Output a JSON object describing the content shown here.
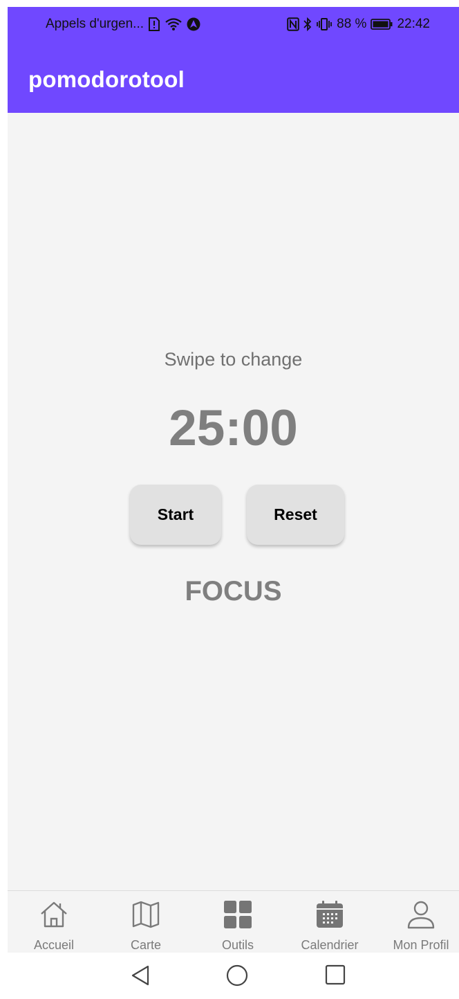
{
  "status_bar": {
    "carrier_text": "Appels d'urgen...",
    "battery_percent": "88 %",
    "time": "22:42"
  },
  "app_bar": {
    "title": "pomodorotool"
  },
  "main": {
    "hint": "Swipe to change",
    "timer": "25:00",
    "start_label": "Start",
    "reset_label": "Reset",
    "mode": "FOCUS"
  },
  "bottom_nav": {
    "items": [
      {
        "label": "Accueil",
        "icon": "home-icon"
      },
      {
        "label": "Carte",
        "icon": "map-icon"
      },
      {
        "label": "Outils",
        "icon": "grid-icon"
      },
      {
        "label": "Calendrier",
        "icon": "calendar-icon"
      },
      {
        "label": "Mon Profil",
        "icon": "person-icon"
      }
    ]
  },
  "colors": {
    "brand": "#7048ff",
    "background": "#f4f4f4",
    "button": "#e1e1e1",
    "text_muted": "#7f7f7f"
  }
}
